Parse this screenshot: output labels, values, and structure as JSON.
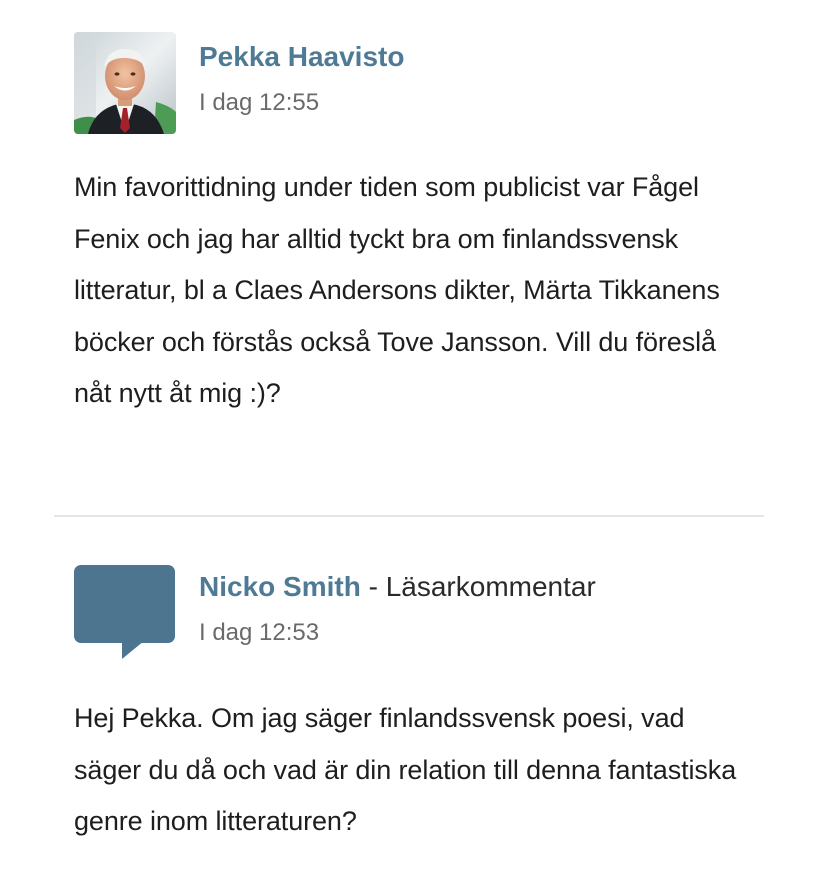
{
  "comments": [
    {
      "author": "Pekka Haavisto",
      "role": "",
      "timestamp": "I dag 12:55",
      "avatar_icon": "portrait-photo",
      "text": "Min favorittidning under tiden som publicist var Fågel Fenix och jag har alltid tyckt bra om finlandssvensk litteratur, bl a Claes Andersons dikter, Märta Tikkanens böcker och förstås också Tove Jansson. Vill du föreslå nåt nytt åt mig :)?"
    },
    {
      "author": "Nicko Smith",
      "separator": " - ",
      "role": "Läsarkommentar",
      "timestamp": "I dag 12:53",
      "avatar_icon": "speech-bubble-icon",
      "text": "Hej Pekka. Om jag säger finlandssvensk poesi, vad säger du då och vad är din relation till denna fantastiska genre inom litteraturen?"
    }
  ],
  "colors": {
    "author_link": "#4e7a96",
    "speech_bubble": "#4d7590",
    "divider": "#e3e6e8"
  }
}
